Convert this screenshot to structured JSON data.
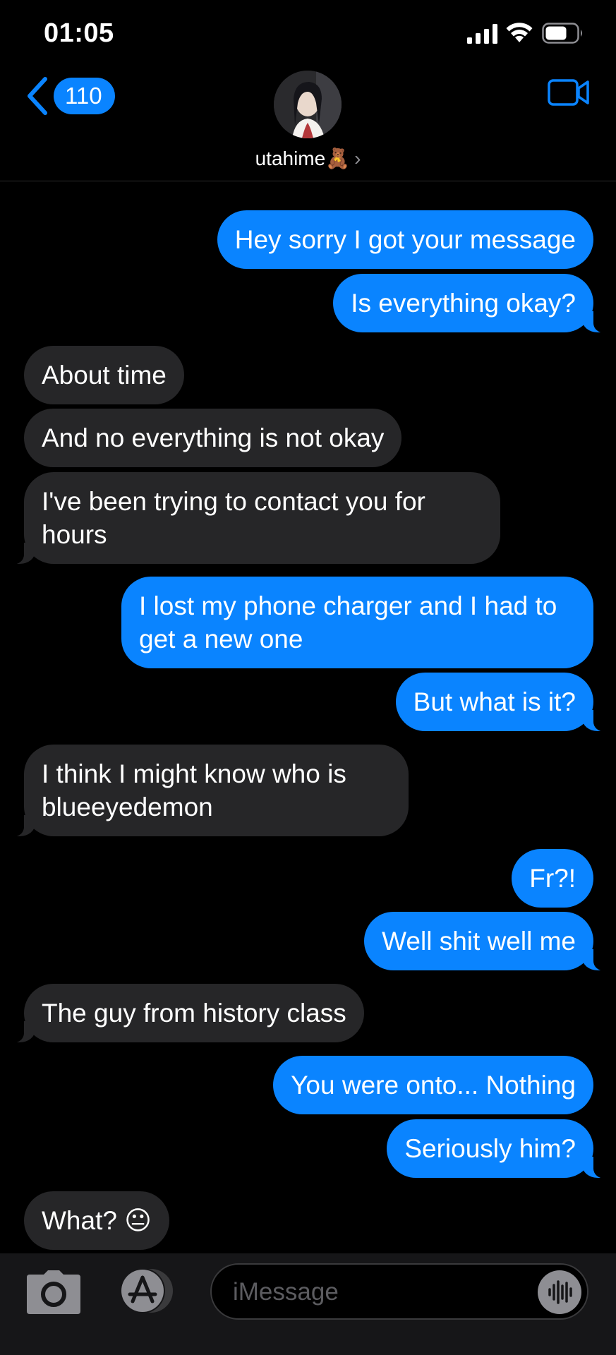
{
  "status_bar": {
    "time": "01:05"
  },
  "header": {
    "back_count": "110",
    "contact_name": "utahime🧸",
    "contact_chevron": "›",
    "icons": {
      "back": "chevron-left-icon",
      "video": "video-camera-icon"
    }
  },
  "messages": [
    {
      "dir": "out",
      "text": "Hey sorry I got your message"
    },
    {
      "dir": "out",
      "text": "Is everything okay?"
    },
    {
      "dir": "in",
      "text": "About time"
    },
    {
      "dir": "in",
      "text": "And no everything is not okay"
    },
    {
      "dir": "in",
      "text": "I've been trying to contact you for hours"
    },
    {
      "dir": "out",
      "text": "I lost my phone charger and I had to get a new one"
    },
    {
      "dir": "out",
      "text": "But what is it?"
    },
    {
      "dir": "in",
      "text": "I think I might know who is blueeyedemon"
    },
    {
      "dir": "out",
      "text": "Fr?!"
    },
    {
      "dir": "out",
      "text": "Well shit well me"
    },
    {
      "dir": "in",
      "text": "The guy from history class"
    },
    {
      "dir": "out",
      "text": "You were onto... Nothing"
    },
    {
      "dir": "out",
      "text": "Seriously him?"
    },
    {
      "dir": "in",
      "text": "What? 😐"
    }
  ],
  "compose": {
    "placeholder": "iMessage",
    "icons": {
      "camera": "camera-icon",
      "apps": "app-store-icon",
      "audio": "waveform-icon"
    }
  },
  "colors": {
    "outgoing": "#0a84ff",
    "incoming": "#262628",
    "background": "#000000"
  }
}
